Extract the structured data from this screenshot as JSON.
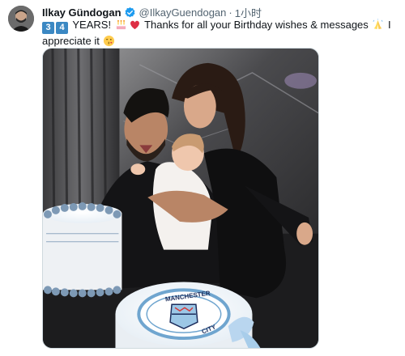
{
  "tweet": {
    "author": {
      "display_name": "Ilkay Gündogan",
      "handle": "@IlkayGuendogan",
      "verified": true
    },
    "separator": "·",
    "time": "1小时",
    "text": {
      "num1": "3",
      "num2": "4",
      "part1": " YEARS! ",
      "part2": " Thanks for all your Birthday wishes & messages ",
      "part3": " I appreciate it "
    },
    "emojis": [
      "birthday-cake-emoji",
      "red-heart-emoji",
      "folded-hands-emoji",
      "kissing-face-emoji"
    ],
    "media": {
      "cake_label_top": "MANCHESTER",
      "cake_label_bottom": "CITY"
    }
  },
  "colors": {
    "accent": "#1d9bf0",
    "keycap": "#3b88c3",
    "text": "#0f1419",
    "muted": "#536471"
  }
}
